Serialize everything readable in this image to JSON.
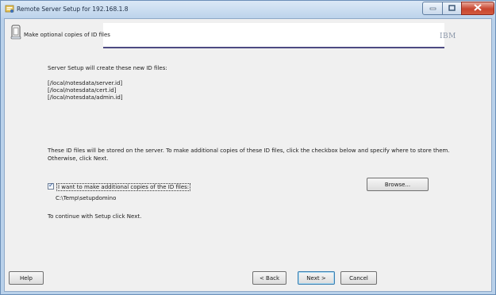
{
  "window": {
    "title": "Remote Server Setup for 192.168.1.8"
  },
  "header": {
    "title": "Make optional copies of ID files",
    "brand": "IBM"
  },
  "content": {
    "intro": "Server Setup will create these new ID files:",
    "id_files": [
      "[/local/notesdata/server.id]",
      "[/local/notesdata/cert.id]",
      "[/local/notesdata/admin.id]"
    ],
    "info_line1": "These ID files will be stored on the server. To make additional copies of these ID files, click the checkbox below and specify where to store them.",
    "info_line2": "Otherwise, click Next.",
    "checkbox_label": "I want to make additional copies of the ID files:",
    "checkbox_checked": true,
    "copy_path": "C:\\Temp\\setupdomino",
    "continue_text": "To continue with Setup click Next."
  },
  "buttons": {
    "browse": "Browse...",
    "help": "Help",
    "back": "< Back",
    "next": "Next >",
    "cancel": "Cancel"
  },
  "icons": {
    "app": "setup-app-icon",
    "minimize": "minimize-icon",
    "maximize": "maximize-icon",
    "close": "close-icon",
    "document": "id-file-document-icon"
  }
}
